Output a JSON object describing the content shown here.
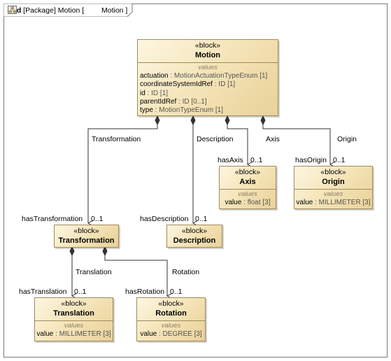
{
  "frame": {
    "kind": "bdd",
    "title_prefix": "[Package] Motion [",
    "title_name": "Motion",
    "title_suffix": "]",
    "icon": "package-diagram-icon"
  },
  "blocks": {
    "motion": {
      "stereotype": "«block»",
      "name": "Motion",
      "compartment": "values",
      "properties": [
        {
          "name": "actuation",
          "type": " : MotionActuationTypeEnum [1]"
        },
        {
          "name": "coordinateSystemIdRef",
          "type": " : ID [1]"
        },
        {
          "name": "id",
          "type": " : ID [1]"
        },
        {
          "name": "parentIdRef",
          "type": " : ID [0..1]"
        },
        {
          "name": "type",
          "type": " : MotionTypeEnum [1]"
        }
      ]
    },
    "axis": {
      "stereotype": "«block»",
      "name": "Axis",
      "compartment": "values",
      "properties": [
        {
          "name": "value",
          "type": " : float [3]"
        }
      ]
    },
    "origin": {
      "stereotype": "«block»",
      "name": "Origin",
      "compartment": "values",
      "properties": [
        {
          "name": "value",
          "type": " : MILLIMETER [3]"
        }
      ]
    },
    "transformation": {
      "stereotype": "«block»",
      "name": "Transformation"
    },
    "description": {
      "stereotype": "«block»",
      "name": "Description"
    },
    "translation": {
      "stereotype": "«block»",
      "name": "Translation",
      "compartment": "values",
      "properties": [
        {
          "name": "value",
          "type": " : MILLIMETER [3]"
        }
      ]
    },
    "rotation": {
      "stereotype": "«block»",
      "name": "Rotation",
      "compartment": "values",
      "properties": [
        {
          "name": "value",
          "type": " : DEGREE [3]"
        }
      ]
    }
  },
  "associations": {
    "transformation": {
      "name": "Transformation",
      "role": "hasTransformation",
      "multiplicity": "0..1"
    },
    "description": {
      "name": "Description",
      "role": "hasDescription",
      "multiplicity": "0..1"
    },
    "axis": {
      "name": "Axis",
      "role": "hasAxis",
      "multiplicity": "0..1"
    },
    "origin": {
      "name": "Origin",
      "role": "hasOrigin",
      "multiplicity": "0..1"
    },
    "translation": {
      "name": "Translation",
      "role": "hasTranslation",
      "multiplicity": "0..1"
    },
    "rotation": {
      "name": "Rotation",
      "role": "hasRotation",
      "multiplicity": "0..1"
    }
  }
}
